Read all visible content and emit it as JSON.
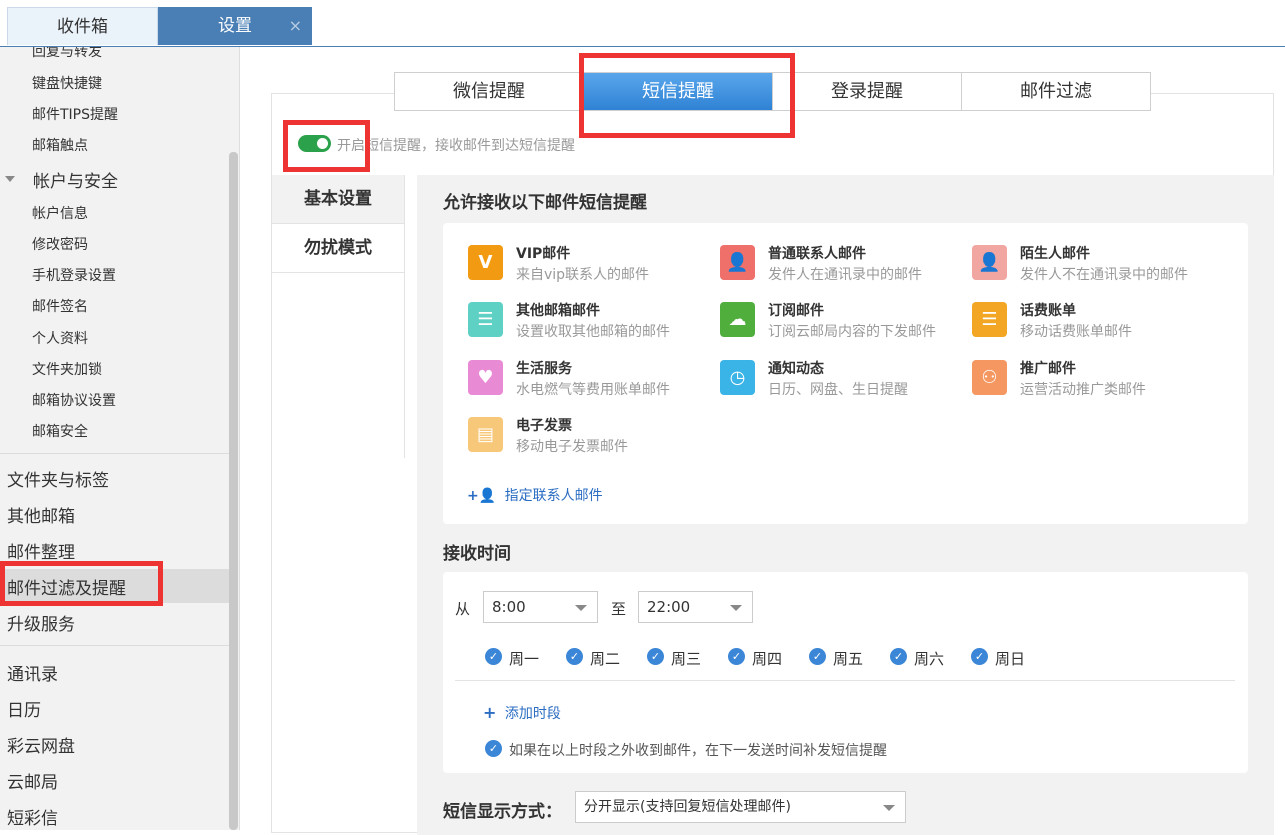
{
  "tabs": {
    "inbox": "收件箱",
    "settings": "设置",
    "close": "×"
  },
  "sidebar": {
    "cutoff": "回复与转发",
    "mail_subitems": [
      "键盘快捷键",
      "邮件TIPS提醒",
      "邮箱触点"
    ],
    "account_group": "帐户与安全",
    "account_subitems": [
      "帐户信息",
      "修改密码",
      "手机登录设置",
      "邮件签名",
      "个人资料",
      "文件夹加锁",
      "邮箱协议设置",
      "邮箱安全"
    ],
    "settings_items": [
      "文件夹与标签",
      "其他邮箱",
      "邮件整理",
      "邮件过滤及提醒",
      "升级服务"
    ],
    "app_items": [
      "通讯录",
      "日历",
      "彩云网盘",
      "云邮局",
      "短彩信"
    ]
  },
  "reminder_tabs": [
    "微信提醒",
    "短信提醒",
    "登录提醒",
    "邮件过滤"
  ],
  "toggle_label": "开启短信提醒，接收邮件到达短信提醒",
  "left_nav": [
    "基本设置",
    "勿扰模式"
  ],
  "allow_section": {
    "title": "允许接收以下邮件短信提醒",
    "types": [
      {
        "icon": "vip-icon",
        "glyph": "V",
        "color": "#f29b12",
        "title": "VIP邮件",
        "desc": "来自vip联系人的邮件"
      },
      {
        "icon": "contact-icon",
        "glyph": "👤",
        "color": "#ef6f6a",
        "title": "普通联系人邮件",
        "desc": "发件人在通讯录中的邮件"
      },
      {
        "icon": "stranger-icon",
        "glyph": "👤",
        "color": "#f1a6a2",
        "title": "陌生人邮件",
        "desc": "发件人不在通讯录中的邮件"
      },
      {
        "icon": "other-mailbox-icon",
        "glyph": "☰",
        "color": "#5fd1c4",
        "title": "其他邮箱邮件",
        "desc": "设置收取其他邮箱的邮件"
      },
      {
        "icon": "subscribe-icon",
        "glyph": "☁",
        "color": "#4fae3c",
        "title": "订阅邮件",
        "desc": "订阅云邮局内容的下发邮件"
      },
      {
        "icon": "bill-icon",
        "glyph": "☰",
        "color": "#f2a623",
        "title": "话费账单",
        "desc": "移动话费账单邮件"
      },
      {
        "icon": "life-service-icon",
        "glyph": "♥",
        "color": "#e98ad5",
        "title": "生活服务",
        "desc": "水电燃气等费用账单邮件"
      },
      {
        "icon": "notify-clock-icon",
        "glyph": "◷",
        "color": "#3ab3e6",
        "title": "通知动态",
        "desc": "日历、网盘、生日提醒"
      },
      {
        "icon": "promo-share-icon",
        "glyph": "⚇",
        "color": "#f49760",
        "title": "推广邮件",
        "desc": "运营活动推广类邮件"
      },
      {
        "icon": "invoice-icon",
        "glyph": "▤",
        "color": "#f8c87a",
        "title": "电子发票",
        "desc": "移动电子发票邮件"
      }
    ],
    "add_contact_link": "指定联系人邮件"
  },
  "time_section": {
    "title": "接收时间",
    "from_label": "从",
    "from_value": "8:00",
    "to_label": "至",
    "to_value": "22:00",
    "days": [
      "周一",
      "周二",
      "周三",
      "周四",
      "周五",
      "周六",
      "周日"
    ],
    "add_period": "添加时段",
    "resend_note": "如果在以上时段之外收到邮件，在下一发送时间补发短信提醒"
  },
  "display_mode": {
    "label": "短信显示方式：",
    "value": "分开显示(支持回复短信处理邮件)"
  }
}
